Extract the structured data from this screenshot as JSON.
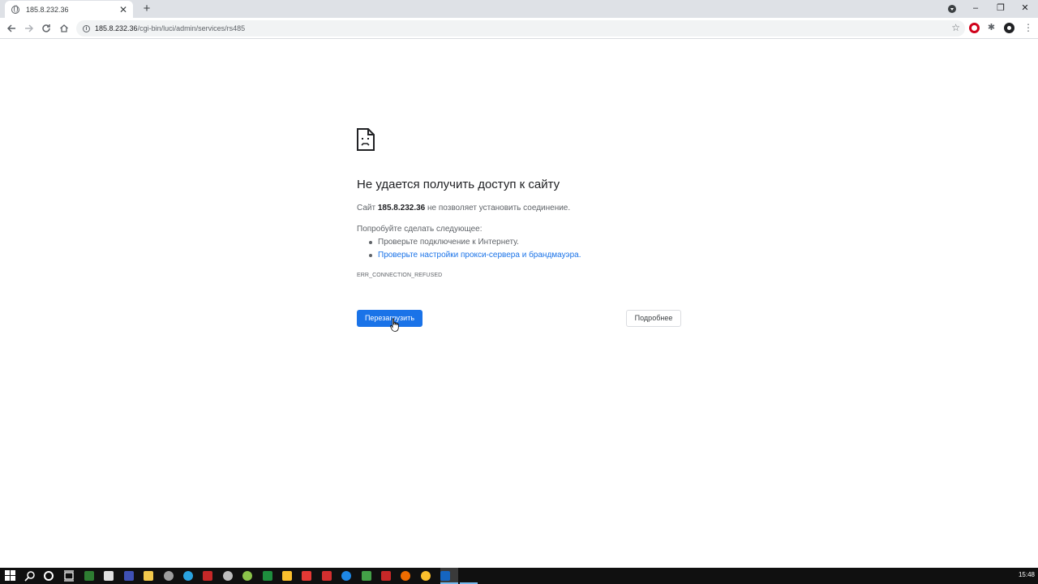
{
  "browser": {
    "tab_title": "185.8.232.36",
    "tab_close": "✕",
    "new_tab": "+",
    "url_host": "185.8.232.36",
    "url_path": "/cgi-bin/luci/admin/services/rs485",
    "window_controls": {
      "minimize": "–",
      "restore": "❐",
      "close": "✕"
    }
  },
  "error_page": {
    "title": "Не удается получить доступ к сайту",
    "desc_prefix": "Сайт",
    "desc_host": "185.8.232.36",
    "desc_suffix": "не позволяет установить соединение.",
    "suggest_heading": "Попробуйте сделать следующее:",
    "suggestions": [
      "Проверьте подключение к Интернету.",
      "Проверьте настройки прокси-сервера и брандмауэра."
    ],
    "error_code": "ERR_CONNECTION_REFUSED",
    "reload_label": "Перезагрузить",
    "details_label": "Подробнее"
  },
  "taskbar": {
    "clock": "15:48",
    "apps": [
      {
        "icon": "file-manager-icon",
        "color": "#2e7d32"
      },
      {
        "icon": "network-tool-icon",
        "color": "#e0e0e0"
      },
      {
        "icon": "notepad-icon",
        "color": "#3f51b5"
      },
      {
        "icon": "folder-icon",
        "color": "#f2c94c"
      },
      {
        "icon": "clock-app-icon",
        "color": "#9e9e9e"
      },
      {
        "icon": "telegram-icon",
        "color": "#2aa3e0"
      },
      {
        "icon": "p-app-icon",
        "color": "#c62828"
      },
      {
        "icon": "sync-icon",
        "color": "#bdbdbd"
      },
      {
        "icon": "green-circle-icon",
        "color": "#8bc34a"
      },
      {
        "icon": "spreadsheet-icon",
        "color": "#1e8e3e"
      },
      {
        "icon": "star-app-icon",
        "color": "#fbc02d"
      },
      {
        "icon": "phone-icon",
        "color": "#e53935"
      },
      {
        "icon": "tool-icon",
        "color": "#d32f2f"
      },
      {
        "icon": "edge-icon",
        "color": "#1e88e5"
      },
      {
        "icon": "terminal-icon",
        "color": "#43a047"
      },
      {
        "icon": "filezilla-icon",
        "color": "#c62828"
      },
      {
        "icon": "firefox-icon",
        "color": "#ef6c00"
      },
      {
        "icon": "chrome-icon",
        "color": "#fbc02d"
      },
      {
        "icon": "editor-icon",
        "color": "#1565c0"
      }
    ]
  }
}
